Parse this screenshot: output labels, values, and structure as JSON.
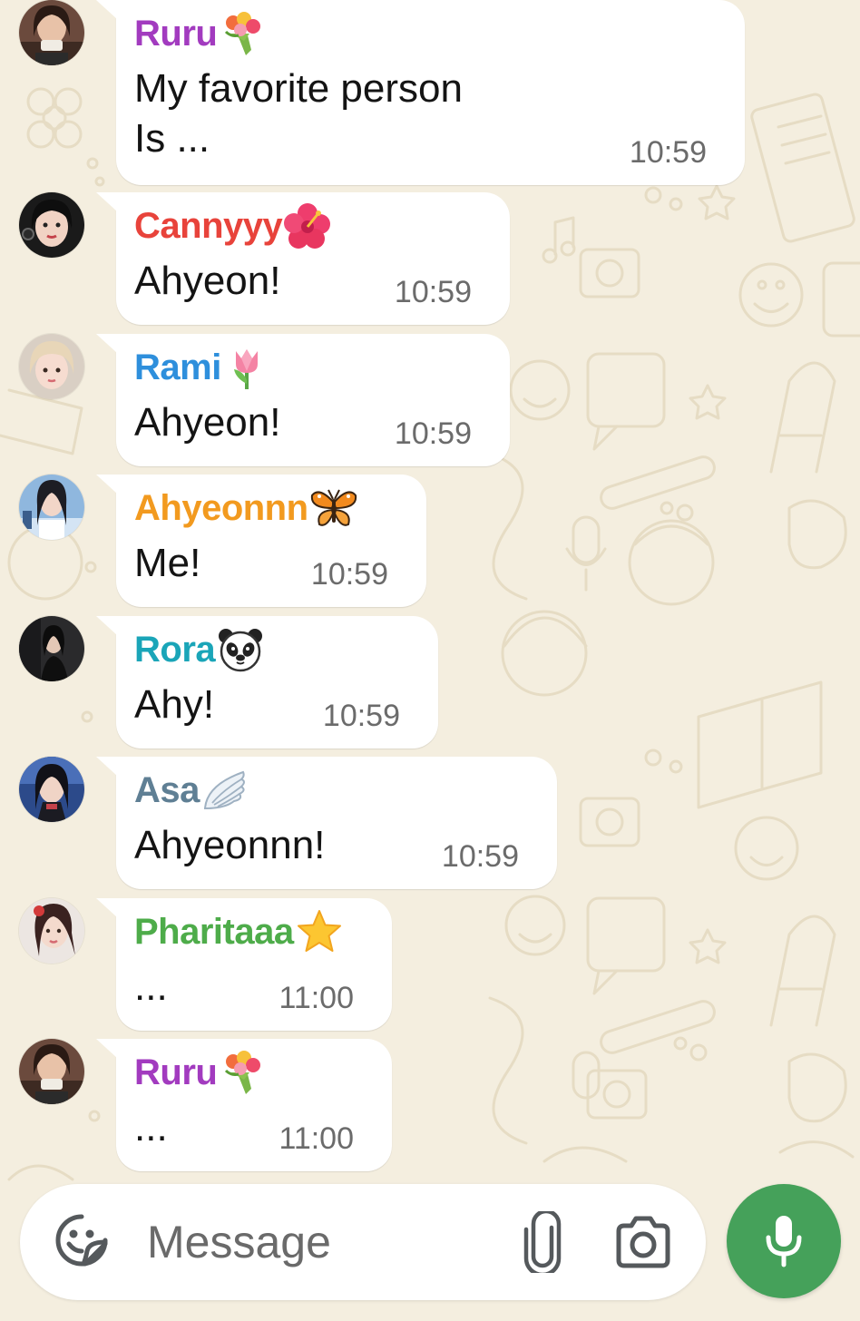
{
  "colors": {
    "chat_background": "#f4eedf",
    "bubble": "#ffffff",
    "timestamp": "#6b6b6b",
    "mic_button": "#45a15a"
  },
  "messages": [
    {
      "sender": "Ruru",
      "sender_color": "#a23bbf",
      "sender_emoji": "bouquet-emoji",
      "lines": [
        "My favorite person",
        "Is ..."
      ],
      "time": "10:59",
      "avatar_icon": "avatar-ruru"
    },
    {
      "sender": "Cannyyy",
      "sender_color": "#e8433b",
      "sender_emoji": "hibiscus-emoji",
      "lines": [
        "Ahyeon!"
      ],
      "time": "10:59",
      "avatar_icon": "avatar-cannyyy"
    },
    {
      "sender": "Rami",
      "sender_color": "#2e8fdc",
      "sender_emoji": "tulip-emoji",
      "lines": [
        "Ahyeon!"
      ],
      "time": "10:59",
      "avatar_icon": "avatar-rami"
    },
    {
      "sender": "Ahyeonnn",
      "sender_color": "#f29a1f",
      "sender_emoji": "butterfly-emoji",
      "lines": [
        "Me!"
      ],
      "time": "10:59",
      "avatar_icon": "avatar-ahyeonnn"
    },
    {
      "sender": "Rora",
      "sender_color": "#1aa5b8",
      "sender_emoji": "panda-emoji",
      "lines": [
        "Ahy!"
      ],
      "time": "10:59",
      "avatar_icon": "avatar-rora"
    },
    {
      "sender": "Asa",
      "sender_color": "#5f7f94",
      "sender_emoji": "wing-emoji",
      "lines": [
        "Ahyeonnn!"
      ],
      "time": "10:59",
      "avatar_icon": "avatar-asa"
    },
    {
      "sender": "Pharitaaa",
      "sender_color": "#4eac4a",
      "sender_emoji": "star-emoji",
      "lines": [
        "..."
      ],
      "time": "11:00",
      "avatar_icon": "avatar-pharitaaa"
    },
    {
      "sender": "Ruru",
      "sender_color": "#a23bbf",
      "sender_emoji": "bouquet-emoji",
      "lines": [
        "..."
      ],
      "time": "11:00",
      "avatar_icon": "avatar-ruru"
    }
  ],
  "input_bar": {
    "placeholder": "Message",
    "value": "",
    "emoji_icon": "sticker-smiley-icon",
    "attach_icon": "paperclip-icon",
    "camera_icon": "camera-icon"
  },
  "mic_button": {
    "icon": "microphone-icon"
  }
}
